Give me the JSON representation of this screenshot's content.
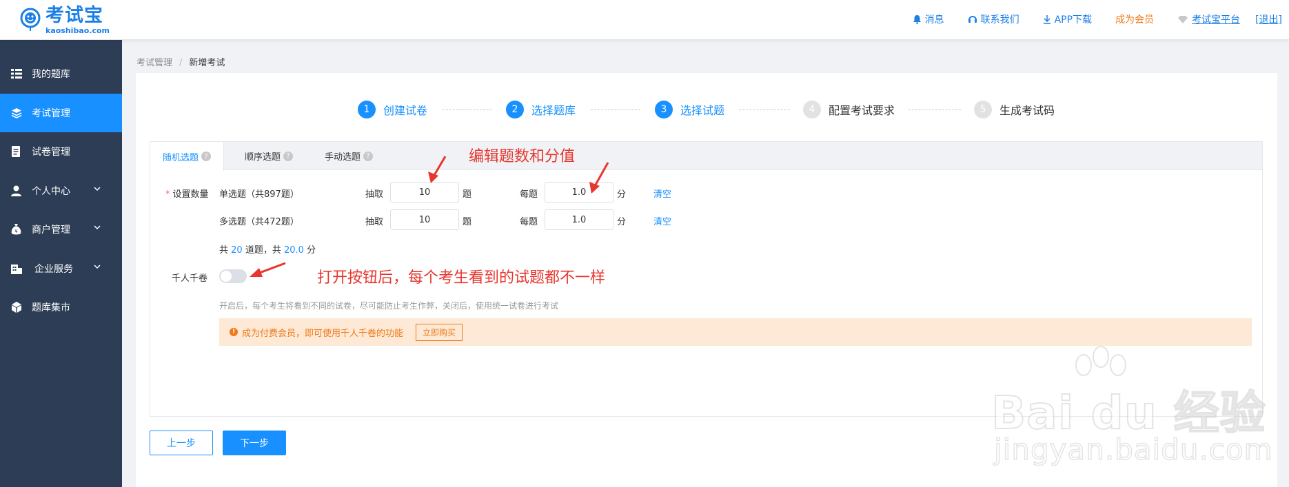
{
  "header": {
    "logo_text": "考试宝",
    "logo_sub": "kaoshibao.com",
    "nav": {
      "messages": "消息",
      "contact": "联系我们",
      "app_download": "APP下载",
      "member": "成为会员",
      "platform": "考试宝平台",
      "logout": "[退出]"
    },
    "colors": {
      "brand": "#1a7fe6",
      "member": "#ee7a1a"
    }
  },
  "sidebar": {
    "colors": {
      "background": "#2c3d55",
      "active": "#1890ff"
    },
    "items": [
      {
        "label": "我的题库",
        "icon": "list-icon"
      },
      {
        "label": "考试管理",
        "icon": "layers-icon",
        "active": true
      },
      {
        "label": "试卷管理",
        "icon": "document-icon"
      },
      {
        "label": "个人中心",
        "icon": "user-icon",
        "expandable": true
      },
      {
        "label": "商户管理",
        "icon": "money-bag-icon",
        "expandable": true
      },
      {
        "label": "企业服务",
        "icon": "building-icon",
        "expandable": true
      },
      {
        "label": "题库集市",
        "icon": "cube-icon"
      }
    ]
  },
  "breadcrumb": {
    "parent": "考试管理",
    "separator": "/",
    "current": "新增考试"
  },
  "steps": [
    {
      "num": "1",
      "label": "创建试卷",
      "state": "done"
    },
    {
      "num": "2",
      "label": "选择题库",
      "state": "done"
    },
    {
      "num": "3",
      "label": "选择试题",
      "state": "done"
    },
    {
      "num": "4",
      "label": "配置考试要求",
      "state": "todo"
    },
    {
      "num": "5",
      "label": "生成考试码",
      "state": "todo"
    }
  ],
  "tabs": [
    {
      "label": "随机选题",
      "active": true
    },
    {
      "label": "顺序选题"
    },
    {
      "label": "手动选题"
    }
  ],
  "form": {
    "required_mark": "*",
    "set_count_label": "设置数量",
    "draw_label": "抽取",
    "question_unit": "题",
    "per_question_label": "每题",
    "score_unit": "分",
    "clear_label": "清空",
    "rows": [
      {
        "type": "单选题",
        "total": "（共897题）",
        "count": "10",
        "score": "1.0"
      },
      {
        "type": "多选题",
        "total": "（共472题）",
        "count": "10",
        "score": "1.0"
      }
    ],
    "summary": {
      "prefix": "共",
      "count": "20",
      "mid": "道题，共",
      "score": "20.0",
      "suffix": "分"
    },
    "thousand_label": "千人千卷",
    "thousand_enabled": false,
    "hint": "开启后，每个考生将看到不同的试卷，尽可能防止考生作弊，关闭后，使用统一试卷进行考试",
    "notice": {
      "text": "成为付费会员，即可使用千人千卷的功能",
      "buy_label": "立即购买"
    }
  },
  "buttons": {
    "prev": "上一步",
    "next": "下一步"
  },
  "annotations": {
    "edit": "编辑题数和分值",
    "toggle": "打开按钮后，每个考生看到的试题都不一样",
    "color": "#e8362e"
  },
  "watermark": {
    "brand": "Bai du 经验",
    "url": "jingyan.baidu.com"
  }
}
